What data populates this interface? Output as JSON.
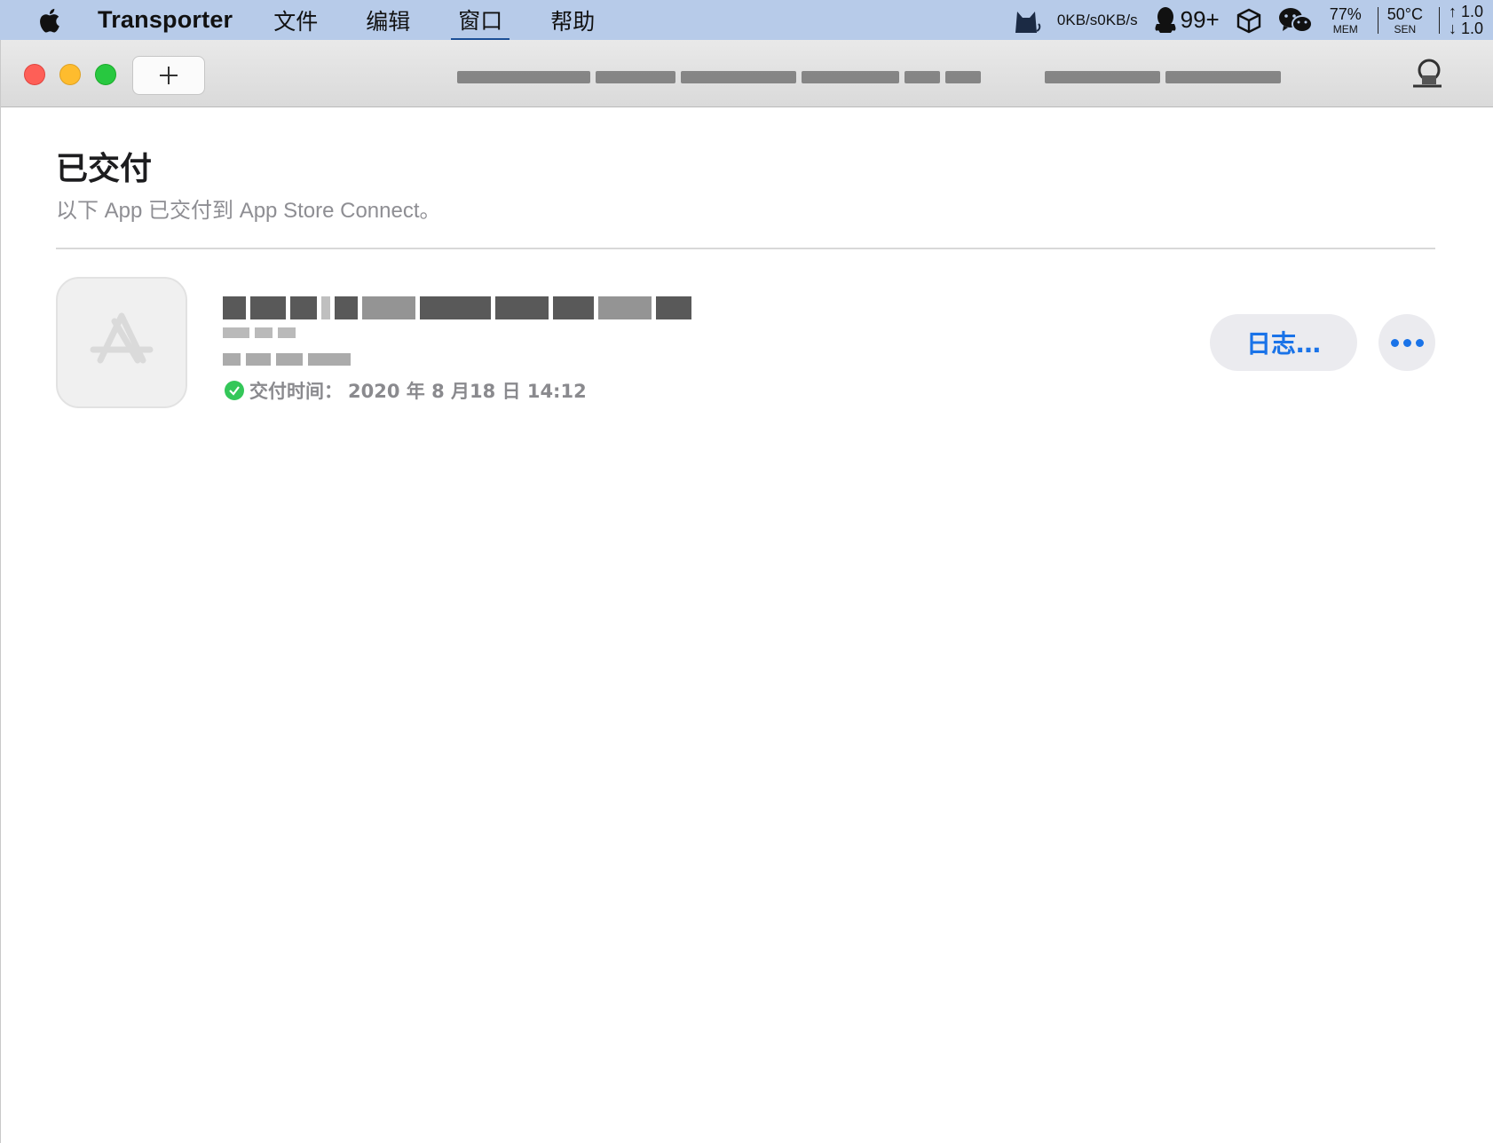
{
  "menubar": {
    "app_name": "Transporter",
    "items": [
      "文件",
      "编辑",
      "窗口",
      "帮助"
    ],
    "net_up": "0KB/s",
    "net_down": "0KB/s",
    "qq_count": "99+",
    "mem_value": "77%",
    "mem_label": "MEM",
    "sen_value": "50°C",
    "sen_label": "SEN",
    "transfer_up": "↑ 1.0",
    "transfer_down": "↓ 1.0"
  },
  "window": {
    "add_button_label": "+"
  },
  "page": {
    "heading": "已交付",
    "subheading": "以下 App 已交付到 App Store Connect。"
  },
  "app_item": {
    "delivered_label": "交付时间：",
    "delivered_value": "2020 年 8 月18 日 14:12",
    "log_button": "日志…"
  },
  "colors": {
    "menubar_bg": "#b7cbe9",
    "accent_blue": "#1a73e8",
    "success_green": "#34c759"
  }
}
